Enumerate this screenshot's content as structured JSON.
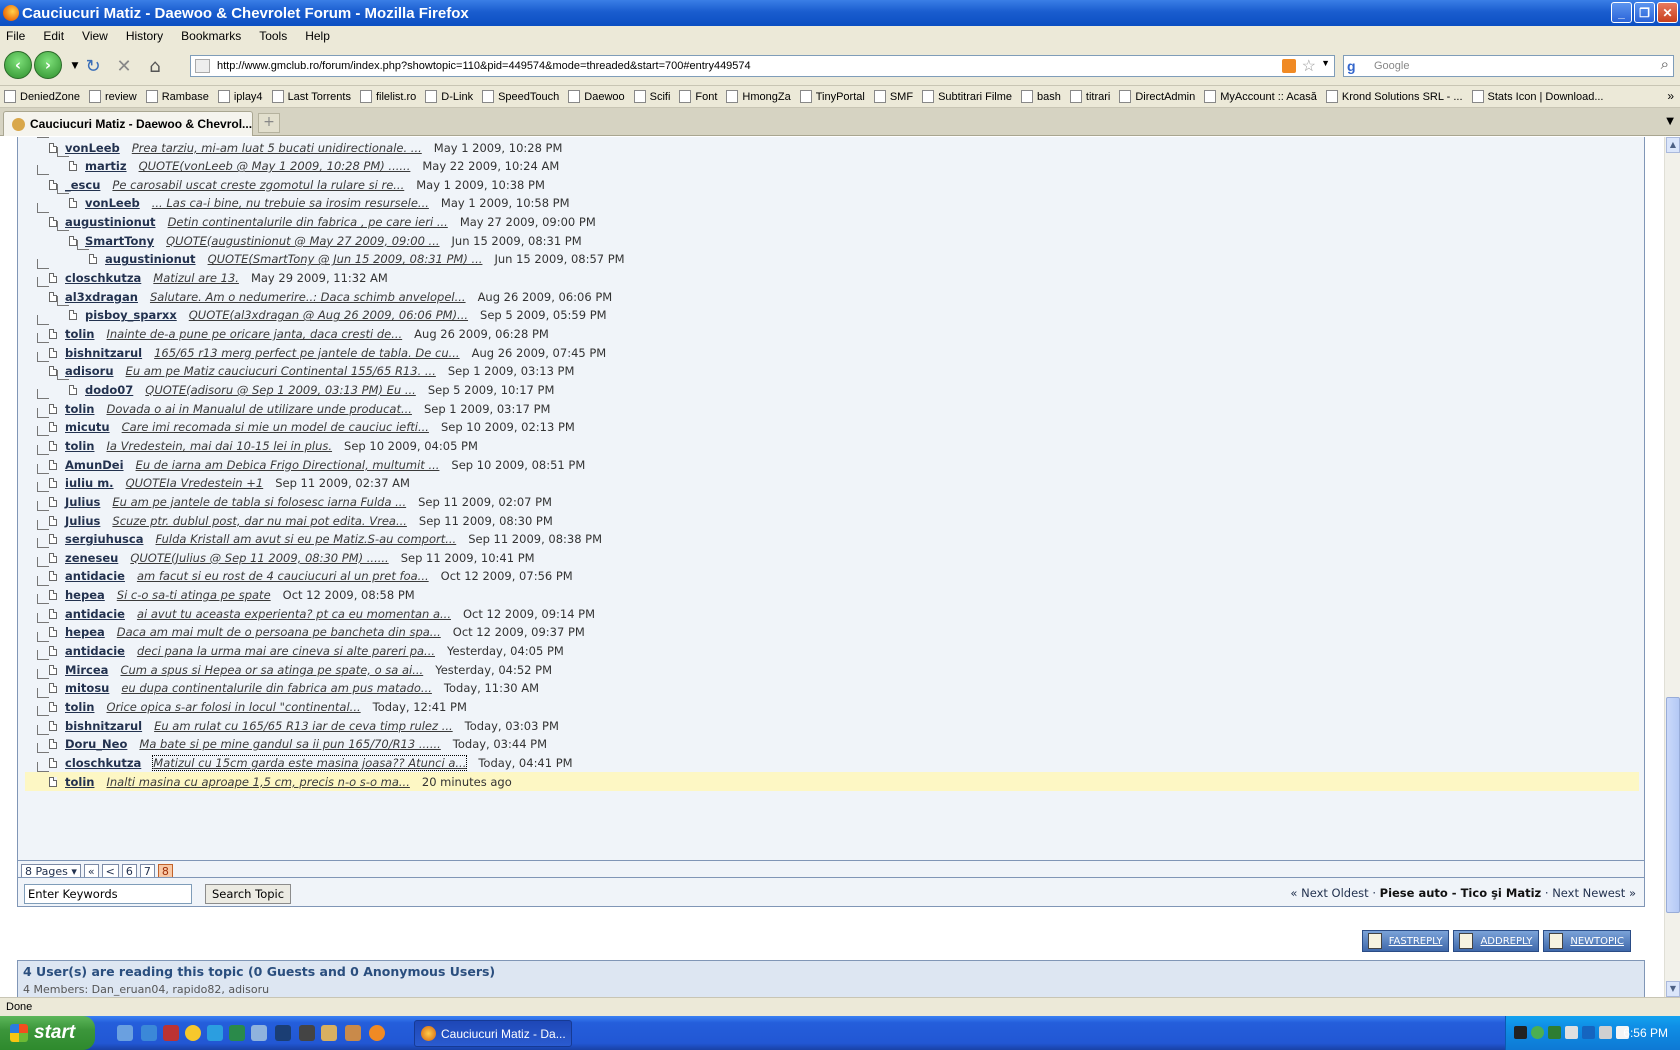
{
  "window": {
    "title": "Cauciucuri Matiz - Daewoo & Chevrolet Forum - Mozilla Firefox"
  },
  "menu": [
    "File",
    "Edit",
    "View",
    "History",
    "Bookmarks",
    "Tools",
    "Help"
  ],
  "nav": {
    "url": "http://www.gmclub.ro/forum/index.php?showtopic=110&pid=449574&mode=threaded&start=700#entry449574",
    "search_placeholder": "Google"
  },
  "bookmarks": [
    "DeniedZone",
    "review",
    "Rambase",
    "iplay4",
    "Last Torrents",
    "filelist.ro",
    "D-Link",
    "SpeedTouch",
    "Daewoo",
    "Scifi",
    "Font",
    "HmongZa",
    "TinyPortal",
    "SMF",
    "Subtitrari Filme",
    "bash",
    "titrari",
    "DirectAdmin",
    "MyAccount :: Acasă",
    "Krond Solutions SRL - ...",
    "Stats Icon | Download..."
  ],
  "tab": {
    "title": "Cauciucuri Matiz - Daewoo & Chevrol..."
  },
  "threads": [
    {
      "depth": 0,
      "user": "vonLeeb",
      "snippet": "Prea tarziu, mi-am luat 5 bucati unidirectionale. ...",
      "date": "May 1 2009, 10:28 PM"
    },
    {
      "depth": 1,
      "user": "martiz",
      "snippet": "QUOTE(vonLeeb @ May 1 2009, 10:28 PM) ......",
      "date": "May 22 2009, 10:24 AM"
    },
    {
      "depth": 0,
      "user": "_escu",
      "snippet": "Pe carosabil uscat creste zgomotul la rulare si re...",
      "date": "May 1 2009, 10:38 PM"
    },
    {
      "depth": 1,
      "user": "vonLeeb",
      "snippet": "... Las ca-i bine, nu trebuie sa irosim resursele...",
      "date": "May 1 2009, 10:58 PM"
    },
    {
      "depth": 0,
      "user": "augustinionut",
      "snippet": "Detin continentalurile din fabrica , pe care ieri ...",
      "date": "May 27 2009, 09:00 PM"
    },
    {
      "depth": 1,
      "user": "SmartTony",
      "snippet": "QUOTE(augustinionut @ May 27 2009, 09:00 ...",
      "date": "Jun 15 2009, 08:31 PM"
    },
    {
      "depth": 2,
      "user": "augustinionut",
      "snippet": "QUOTE(SmartTony @ Jun 15 2009, 08:31 PM) ...",
      "date": "Jun 15 2009, 08:57 PM"
    },
    {
      "depth": 0,
      "user": "closchkutza",
      "snippet": "Matizul are 13.",
      "date": "May 29 2009, 11:32 AM"
    },
    {
      "depth": 0,
      "user": "al3xdragan",
      "snippet": "Salutare. Am o nedumerire..: Daca schimb anvelopel...",
      "date": "Aug 26 2009, 06:06 PM"
    },
    {
      "depth": 1,
      "user": "pisboy_sparxx",
      "snippet": "QUOTE(al3xdragan @ Aug 26 2009, 06:06 PM)...",
      "date": "Sep 5 2009, 05:59 PM"
    },
    {
      "depth": 0,
      "user": "tolin",
      "snippet": "Inainte de-a pune pe oricare janta, daca cresti de...",
      "date": "Aug 26 2009, 06:28 PM"
    },
    {
      "depth": 0,
      "user": "bishnitzarul",
      "snippet": "165/65 r13 merg perfect pe jantele de tabla. De cu...",
      "date": "Aug 26 2009, 07:45 PM"
    },
    {
      "depth": 0,
      "user": "adisoru",
      "snippet": "Eu am pe Matiz cauciucuri Continental 155/65 R13. ...",
      "date": "Sep 1 2009, 03:13 PM"
    },
    {
      "depth": 1,
      "user": "dodo07",
      "snippet": "QUOTE(adisoru @ Sep 1 2009, 03:13 PM) Eu ...",
      "date": "Sep 5 2009, 10:17 PM"
    },
    {
      "depth": 0,
      "user": "tolin",
      "snippet": "Dovada o ai in Manualul de utilizare unde producat...",
      "date": "Sep 1 2009, 03:17 PM"
    },
    {
      "depth": 0,
      "user": "micutu",
      "snippet": "Care imi recomada si mie un model de cauciuc iefti...",
      "date": "Sep 10 2009, 02:13 PM"
    },
    {
      "depth": 0,
      "user": "tolin",
      "snippet": "Ia Vredestein, mai dai 10-15 lei in plus.",
      "date": "Sep 10 2009, 04:05 PM"
    },
    {
      "depth": 0,
      "user": "AmunDei",
      "snippet": "Eu de iarna am Debica Frigo Directional, multumit ...",
      "date": "Sep 10 2009, 08:51 PM"
    },
    {
      "depth": 0,
      "user": "iuliu m.",
      "snippet": "QUOTEIa Vredestein +1",
      "date": "Sep 11 2009, 02:37 AM"
    },
    {
      "depth": 0,
      "user": "Julius",
      "snippet": "Eu am pe jantele de tabla si folosesc iarna Fulda ...",
      "date": "Sep 11 2009, 02:07 PM"
    },
    {
      "depth": 0,
      "user": "Julius",
      "snippet": "Scuze ptr. dublul post, dar nu mai pot edita. Vrea...",
      "date": "Sep 11 2009, 08:30 PM"
    },
    {
      "depth": 0,
      "user": "sergiuhusca",
      "snippet": "Fulda Kristall am avut si eu pe Matiz.S-au comport...",
      "date": "Sep 11 2009, 08:38 PM"
    },
    {
      "depth": 0,
      "user": "zeneseu",
      "snippet": "QUOTE(Julius @ Sep 11 2009, 08:30 PM) ......",
      "date": "Sep 11 2009, 10:41 PM"
    },
    {
      "depth": 0,
      "user": "antidacie",
      "snippet": "am facut si eu rost de 4 cauciucuri al un pret foa...",
      "date": "Oct 12 2009, 07:56 PM"
    },
    {
      "depth": 0,
      "user": "hepea",
      "snippet": "Si c-o sa-ti atinga pe spate",
      "date": "Oct 12 2009, 08:58 PM"
    },
    {
      "depth": 0,
      "user": "antidacie",
      "snippet": "ai avut tu aceasta experienta? pt ca eu momentan a...",
      "date": "Oct 12 2009, 09:14 PM"
    },
    {
      "depth": 0,
      "user": "hepea",
      "snippet": "Daca am mai mult de o persoana pe bancheta din spa...",
      "date": "Oct 12 2009, 09:37 PM"
    },
    {
      "depth": 0,
      "user": "antidacie",
      "snippet": "deci pana la urma mai are cineva si alte pareri pa...",
      "date": "Yesterday, 04:05 PM"
    },
    {
      "depth": 0,
      "user": "Mircea",
      "snippet": "Cum a spus si Hepea or sa atinga pe spate, o sa ai...",
      "date": "Yesterday, 04:52 PM"
    },
    {
      "depth": 0,
      "user": "mitosu",
      "snippet": "eu dupa continentalurile din fabrica am pus matado...",
      "date": "Today, 11:30 AM"
    },
    {
      "depth": 0,
      "user": "tolin",
      "snippet": "Orice opica s-ar folosi in locul \"continental...",
      "date": "Today, 12:41 PM"
    },
    {
      "depth": 0,
      "user": "bishnitzarul",
      "snippet": "Eu am rulat cu 165/65 R13 iar de ceva timp rulez ...",
      "date": "Today, 03:03 PM"
    },
    {
      "depth": 0,
      "user": "Doru_Neo",
      "snippet": "Ma bate si pe mine gandul sa ii pun 165/70/R13 ......",
      "date": "Today, 03:44 PM"
    },
    {
      "depth": 0,
      "user": "closchkutza",
      "snippet": "Matizul cu 15cm garda este masina joasa?? Atunci a...",
      "date": "Today, 04:41 PM",
      "focused": true
    },
    {
      "depth": 0,
      "user": "tolin",
      "snippet": "Inalti masina cu aproape 1,5 cm, precis n-o s-o ma...",
      "date": "20 minutes ago",
      "highlight": true
    }
  ],
  "pager": {
    "pages_label": "8 Pages",
    "first": "«",
    "prev": "<",
    "pages": [
      "6",
      "7",
      "8"
    ],
    "current": "8"
  },
  "search": {
    "placeholder": "Enter Keywords",
    "button": "Search Topic"
  },
  "topic_nav": {
    "prev": "« Next Oldest",
    "sep1": " · ",
    "forum": "Piese auto - Tico şi Matiz",
    "sep2": " · ",
    "next": "Next Newest »"
  },
  "actions": [
    "FASTREPLY",
    "ADDREPLY",
    "NEWTOPIC"
  ],
  "readers": {
    "heading": "4 User(s) are reading this topic (0 Guests and 0 Anonymous Users)",
    "members": "4 Members: Dan_eruan04, rapido82, adisoru"
  },
  "status": "Done",
  "taskbar": {
    "start": "start",
    "active_window": "Cauciucuri Matiz - Da...",
    "clock": "6:56 PM"
  }
}
